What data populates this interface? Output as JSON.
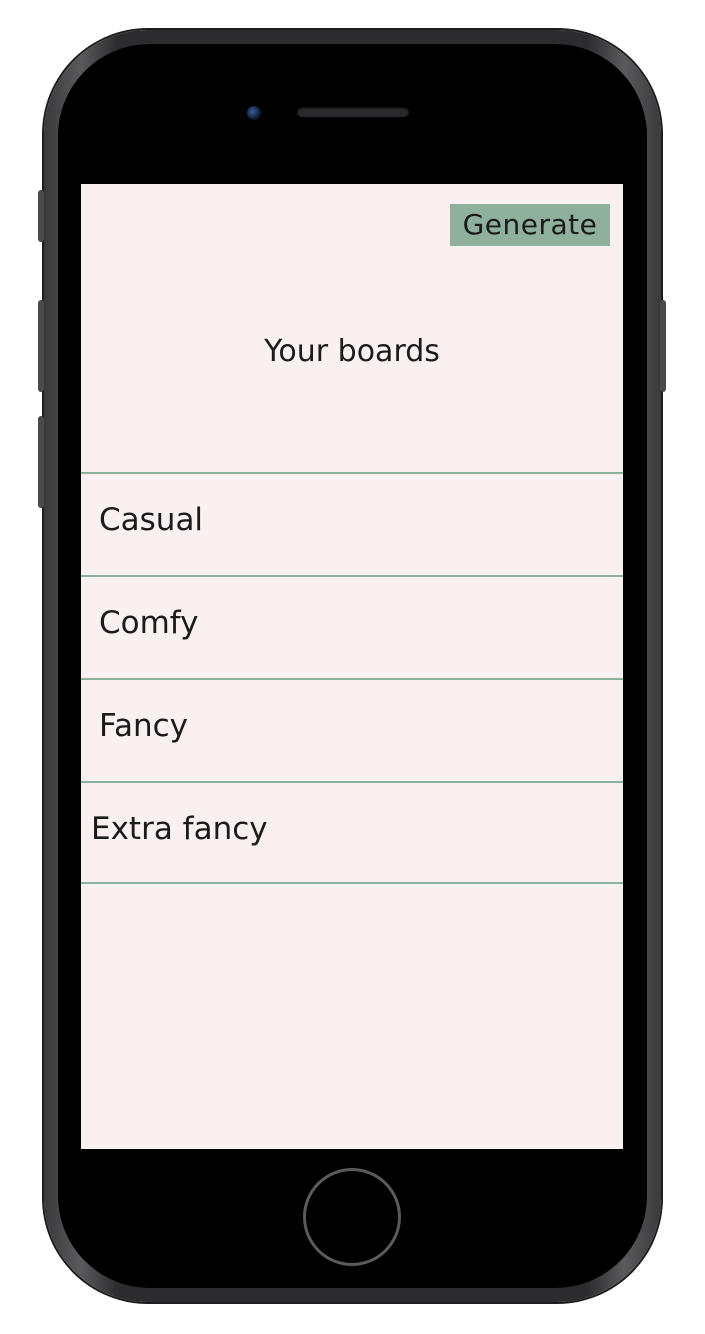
{
  "header": {
    "generate_label": "Generate"
  },
  "main": {
    "title": "Your boards",
    "boards": [
      {
        "label": "Casual"
      },
      {
        "label": "Comfy"
      },
      {
        "label": "Fancy"
      },
      {
        "label": "Extra fancy"
      }
    ]
  },
  "colors": {
    "accent": "#8fb09d",
    "background": "#f9f1ef",
    "text": "#1b1b1b"
  }
}
